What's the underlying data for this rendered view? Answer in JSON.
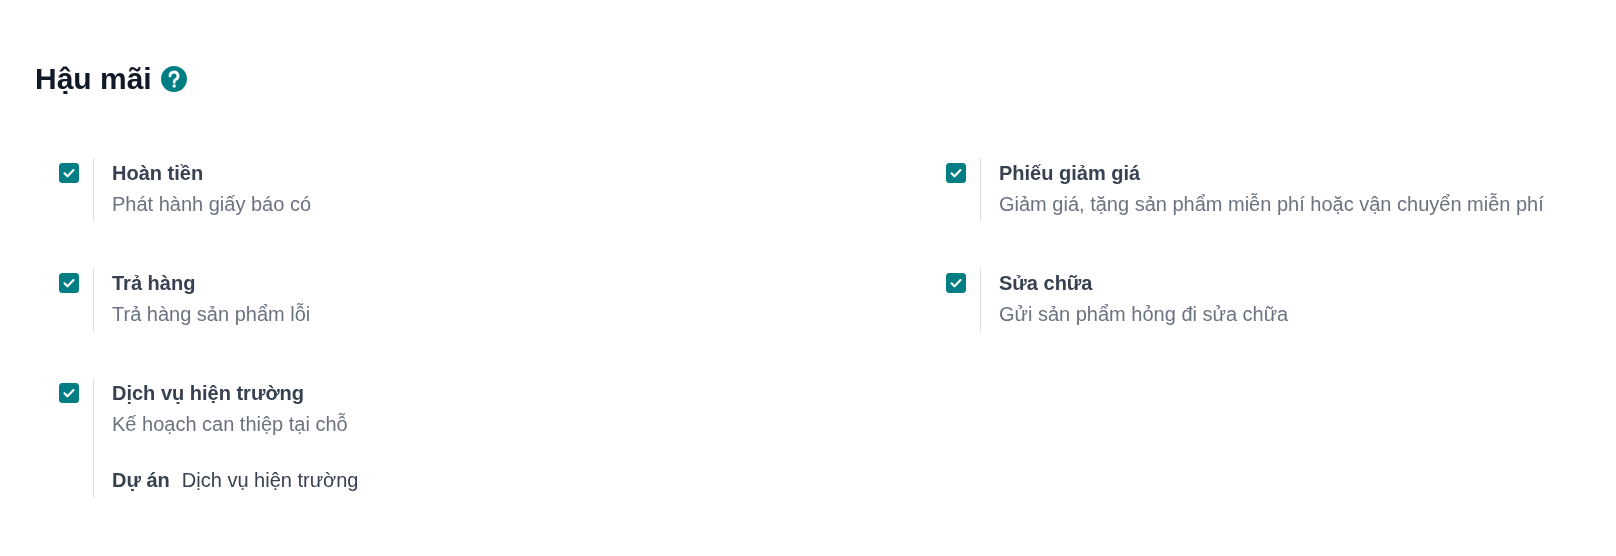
{
  "section": {
    "title": "Hậu mãi"
  },
  "settings": [
    {
      "label": "Hoàn tiền",
      "description": "Phát hành giấy báo có",
      "checked": true
    },
    {
      "label": "Phiếu giảm giá",
      "description": "Giảm giá, tặng sản phẩm miễn phí hoặc vận chuyển miễn phí",
      "checked": true
    },
    {
      "label": "Trả hàng",
      "description": "Trả hàng sản phẩm lỗi",
      "checked": true
    },
    {
      "label": "Sửa chữa",
      "description": "Gửi sản phẩm hỏng đi sửa chữa",
      "checked": true
    },
    {
      "label": "Dịch vụ hiện trường",
      "description": "Kế hoạch can thiệp tại chỗ",
      "checked": true,
      "fields": [
        {
          "label": "Dự án",
          "value": "Dịch vụ hiện trường"
        }
      ]
    }
  ]
}
